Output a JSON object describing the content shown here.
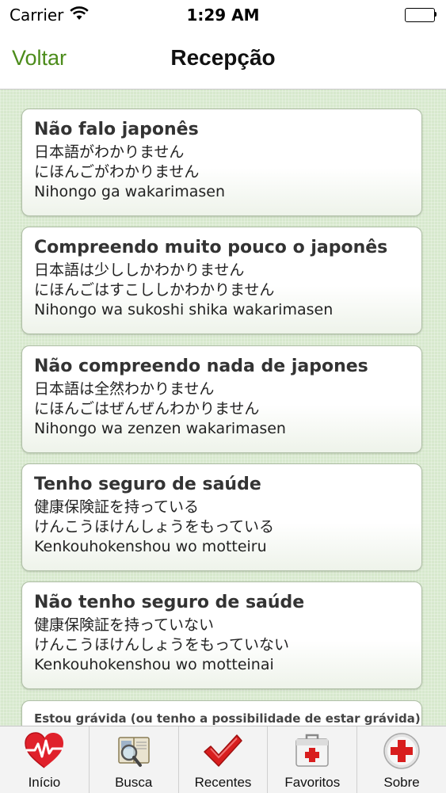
{
  "status_bar": {
    "carrier": "Carrier",
    "time": "1:29 AM"
  },
  "nav": {
    "back_label": "Voltar",
    "title": "Recepção"
  },
  "phrases": [
    {
      "title": "Não falo japonês",
      "kanji": "日本語がわかりません",
      "kana": "にほんごがわかりません",
      "romaji": "Nihongo ga wakarimasen"
    },
    {
      "title": "Compreendo muito pouco o japonês",
      "kanji": "日本語は少ししかわかりません",
      "kana": "にほんごはすこししかわかりません",
      "romaji": "Nihongo wa sukoshi shika wakarimasen"
    },
    {
      "title": "Não compreendo nada de japones",
      "kanji": "日本語は全然わかりません",
      "kana": "にほんごはぜんぜんわかりません",
      "romaji": "Nihongo wa zenzen wakarimasen"
    },
    {
      "title": "Tenho seguro de saúde",
      "kanji": "健康保険証を持っている",
      "kana": "けんこうほけんしょうをもっている",
      "romaji": "Kenkouhokenshou wo motteiru"
    },
    {
      "title": "Não tenho seguro de saúde",
      "kanji": "健康保険証を持っていない",
      "kana": "けんこうほけんしょうをもっていない",
      "romaji": "Kenkouhokenshou wo motteinai"
    },
    {
      "title": "Estou grávida (ou tenho a possibilidade de estar grávida)"
    }
  ],
  "tabs": [
    {
      "label": "Início",
      "icon": "heart-pulse-icon"
    },
    {
      "label": "Busca",
      "icon": "book-magnifier-icon"
    },
    {
      "label": "Recentes",
      "icon": "checkmark-icon"
    },
    {
      "label": "Favoritos",
      "icon": "first-aid-kit-icon"
    },
    {
      "label": "Sobre",
      "icon": "red-cross-icon"
    }
  ],
  "colors": {
    "accent": "#4c8c1b",
    "background": "#d7e8cd",
    "heart": "#e0212b",
    "check": "#d81e1e"
  }
}
